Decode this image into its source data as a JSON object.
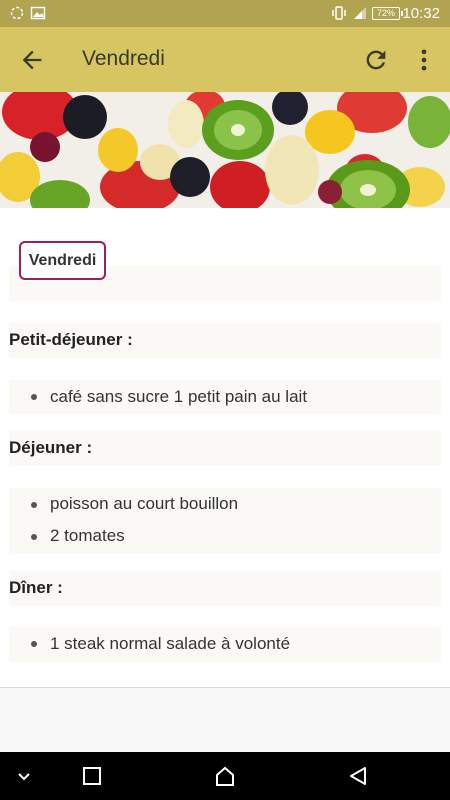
{
  "status_bar": {
    "time": "10:32",
    "battery": "72%"
  },
  "app_bar": {
    "title": "Vendredi"
  },
  "content": {
    "day_badge": "Vendredi",
    "sections": [
      {
        "heading": "Petit-déjeuner :",
        "items": [
          "café sans sucre 1 petit pain au lait"
        ]
      },
      {
        "heading": "Déjeuner :",
        "items": [
          "poisson au court bouillon",
          "2 tomates"
        ]
      },
      {
        "heading": "Dîner :",
        "items": [
          "1 steak normal salade à volonté"
        ]
      }
    ]
  },
  "colors": {
    "status_bar": "#b1a350",
    "app_bar": "#d6c561",
    "badge_border": "#9c1f5b",
    "strip": "#fbf9f5"
  }
}
